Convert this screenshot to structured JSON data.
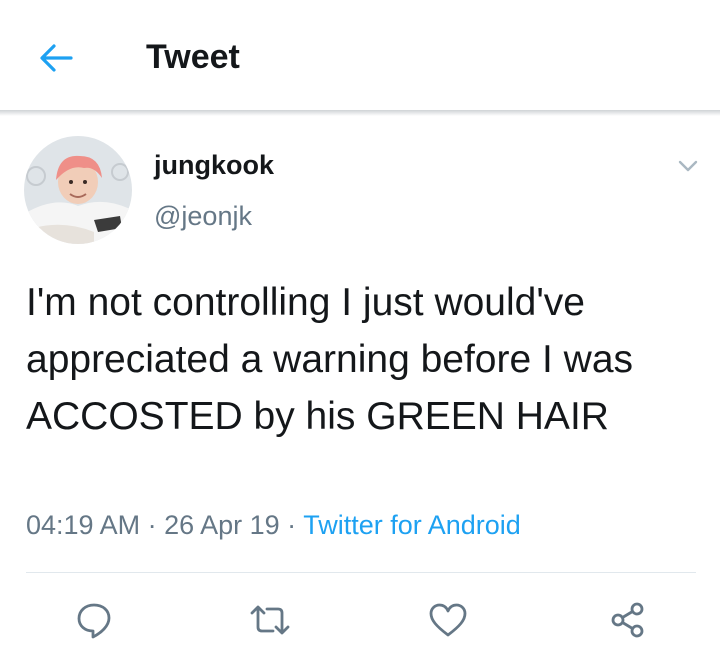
{
  "header": {
    "title": "Tweet",
    "back_icon": "arrow-left-icon",
    "accent": "#1da1f2"
  },
  "tweet": {
    "author_name": "jungkook",
    "author_handle": "@jeonjk",
    "text": "I'm not controlling I just would've appreciated a warning before I was ACCOSTED by his GREEN HAIR",
    "time": "04:19 AM",
    "date": "26 Apr 19",
    "separator": " · ",
    "source": "Twitter for Android",
    "source_color": "#1da1f2"
  },
  "actions": [
    {
      "name": "reply",
      "icon": "reply-icon"
    },
    {
      "name": "retweet",
      "icon": "retweet-icon"
    },
    {
      "name": "like",
      "icon": "heart-icon"
    },
    {
      "name": "share",
      "icon": "share-icon"
    }
  ]
}
